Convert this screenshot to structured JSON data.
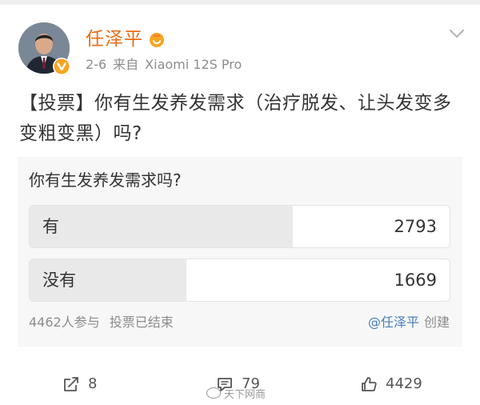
{
  "header": {
    "username": "任泽平",
    "date": "2-6",
    "source_prefix": "来自",
    "source_device": "Xiaomi 12S Pro"
  },
  "post": {
    "text": "【投票】你有生发养发需求（治疗脱发、让头发变多变粗变黑）吗?"
  },
  "poll": {
    "question": "你有生发养发需求吗?",
    "options": [
      {
        "label": "有",
        "count": "2793",
        "share": 0.626
      },
      {
        "label": "没有",
        "count": "1669",
        "share": 0.374
      }
    ],
    "participants": "4462人参与",
    "status": "投票已结束",
    "creator": "@任泽平",
    "created_label": "创建"
  },
  "actions": {
    "reposts": "8",
    "comments": "79",
    "likes": "4429"
  },
  "watermark": "天下网商",
  "colors": {
    "username": "#e86c14",
    "link": "#4a7db8",
    "poll_bg": "#f7f7f7",
    "bar_fill": "#e9e9e9"
  },
  "icons": [
    "avatar",
    "verified-badge-icon",
    "fan-badge-icon",
    "chevron-down-icon",
    "repost-icon",
    "comment-icon",
    "like-icon"
  ]
}
